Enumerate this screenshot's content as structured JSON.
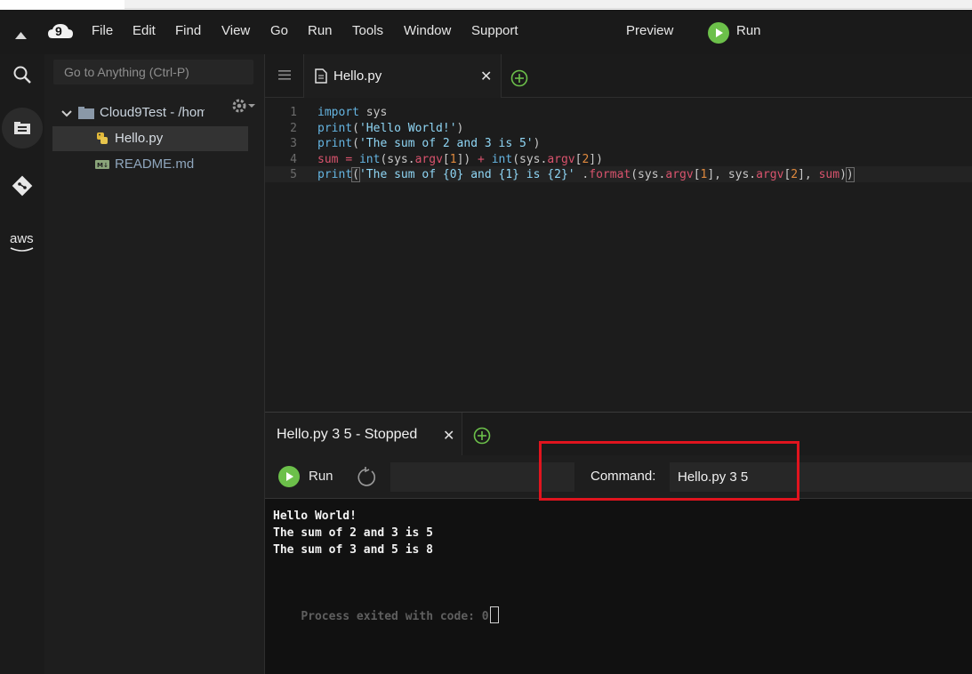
{
  "menubar": {
    "items": [
      "File",
      "Edit",
      "Find",
      "View",
      "Go",
      "Run",
      "Tools",
      "Window",
      "Support"
    ],
    "preview_label": "Preview",
    "run_label": "Run",
    "logo_text": "9"
  },
  "sidebar_tools": [
    "search-icon",
    "folder-icon",
    "git-icon",
    "aws-icon"
  ],
  "aws_label": "aws",
  "explorer": {
    "goto_placeholder": "Go to Anything (Ctrl-P)",
    "project": "Cloud9Test - /hom",
    "files": [
      {
        "name": "Hello.py",
        "icon": "python-icon",
        "selected": true
      },
      {
        "name": "README.md",
        "icon": "markdown-icon",
        "selected": false
      }
    ]
  },
  "editor": {
    "tab_label": "Hello.py",
    "line_numbers": [
      "1",
      "2",
      "3",
      "4",
      "5"
    ]
  },
  "runner": {
    "tab_label": "Hello.py 3 5 - Stopped",
    "run_label": "Run",
    "command_label": "Command:",
    "command_value": "Hello.py 3 5"
  },
  "terminal": {
    "lines": [
      "Hello World!",
      "The sum of 2 and 3 is 5",
      "The sum of 3 and 5 is 8"
    ],
    "exit_text": "Process exited with code: 0"
  },
  "colors": {
    "accent_green": "#6cc04a",
    "highlight_red": "#e0141e",
    "background": "#1d1d1d"
  }
}
